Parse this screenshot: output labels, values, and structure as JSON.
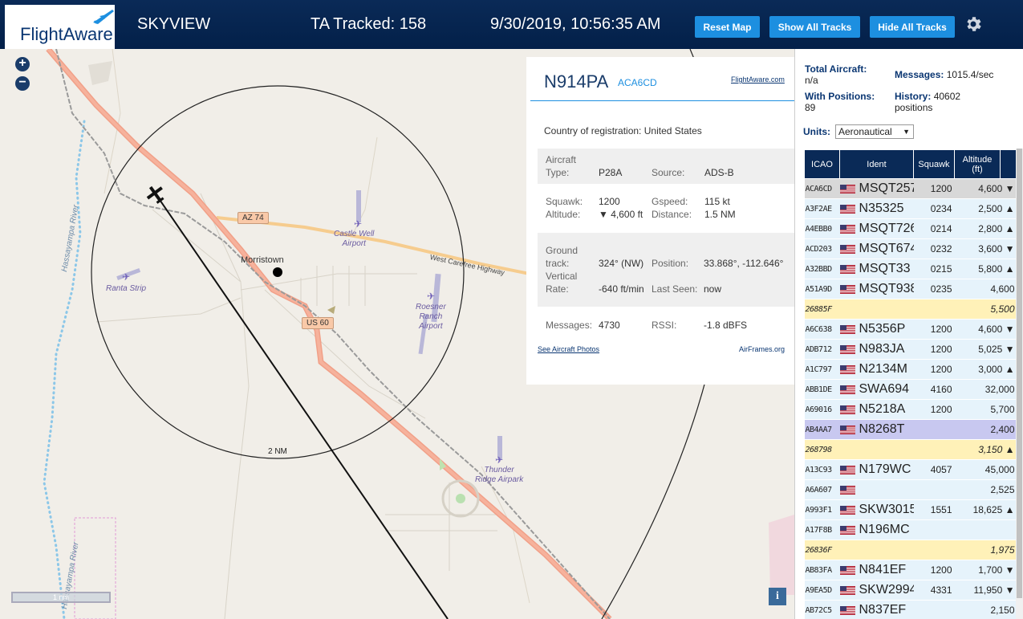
{
  "header": {
    "logo_text": "FlightAware",
    "title": "SKYVIEW",
    "tracked": "TA Tracked: 158",
    "datetime": "9/30/2019, 10:56:35 AM",
    "reset_map": "Reset Map",
    "show_all": "Show All Tracks",
    "hide_all": "Hide All Tracks"
  },
  "map": {
    "zoom_in": "+",
    "zoom_out": "−",
    "scale": "1 nm",
    "range_label": "2 NM",
    "info": "i",
    "town": "Morristown",
    "shields": [
      "AZ 74",
      "US 60"
    ],
    "highway": "West Carefree Highway",
    "river_1": "Hassayampa River",
    "river_2": "Hassayampa River",
    "airports": {
      "castle_well": "Castle Well\nAirport",
      "ranta": "Ranta Strip",
      "roesner": "Roesner\nRanch\nAirport",
      "thunder": "Thunder\nRidge Airpark"
    }
  },
  "selected": {
    "ident": "N914PA",
    "icao": "ACA6CD",
    "fa_link": "FlightAware.com",
    "country_label": "Country of registration:",
    "country": "United States",
    "aircraft_type_label": "Aircraft\nType:",
    "aircraft_type": "P28A",
    "source_label": "Source:",
    "source": "ADS-B",
    "squawk_label": "Squawk:",
    "squawk": "1200",
    "altitude_label": "Altitude:",
    "altitude": "▼ 4,600 ft",
    "gspeed_label": "Gspeed:",
    "gspeed": "115 kt",
    "distance_label": "Distance:",
    "distance": "1.5 NM",
    "track_label": "Ground\ntrack:",
    "track": "324° (NW)",
    "position_label": "Position:",
    "position": "33.868°, -112.646°",
    "vrate_label": "Vertical\nRate:",
    "vrate": "-640 ft/min",
    "lastseen_label": "Last Seen:",
    "lastseen": "now",
    "messages_label": "Messages:",
    "messages": "4730",
    "rssi_label": "RSSI:",
    "rssi": "-1.8 dBFS",
    "photos_link": "See Aircraft Photos",
    "airframes_link": "AirFrames.org"
  },
  "stats": {
    "total_label": "Total Aircraft:",
    "total": "n/a",
    "messages_label": "Messages:",
    "messages": "1015.4/sec",
    "withpos_label": "With Positions:",
    "withpos": "89",
    "history_label": "History:",
    "history": "40602 positions"
  },
  "units": {
    "label": "Units:",
    "value": "Aeronautical"
  },
  "table": {
    "headers": [
      "ICAO",
      "Ident",
      "Squawk",
      "Altitude\n(ft)"
    ],
    "rows": [
      {
        "icao": "ACA6CD",
        "flag": true,
        "ident": "MSQT257",
        "squawk": "1200",
        "alt": "4,600 ▼",
        "state": "selected"
      },
      {
        "icao": "A3F2AE",
        "flag": true,
        "ident": "N35325",
        "squawk": "0234",
        "alt": "2,500 ▲",
        "state": ""
      },
      {
        "icao": "A4EBB0",
        "flag": true,
        "ident": "MSQT726",
        "squawk": "0214",
        "alt": "2,800 ▲",
        "state": ""
      },
      {
        "icao": "ACD203",
        "flag": true,
        "ident": "MSQT674",
        "squawk": "0232",
        "alt": "3,600 ▼",
        "state": ""
      },
      {
        "icao": "A32BBD",
        "flag": true,
        "ident": "MSQT33",
        "squawk": "0215",
        "alt": "5,800 ▲",
        "state": ""
      },
      {
        "icao": "A51A9D",
        "flag": true,
        "ident": "MSQT938",
        "squawk": "0235",
        "alt": "4,600",
        "state": ""
      },
      {
        "icao": "26885F",
        "flag": false,
        "ident": "",
        "squawk": "",
        "alt": "5,500",
        "state": "nopos"
      },
      {
        "icao": "A6C638",
        "flag": true,
        "ident": "N5356P",
        "squawk": "1200",
        "alt": "4,600 ▼",
        "state": ""
      },
      {
        "icao": "ADB712",
        "flag": true,
        "ident": "N983JA",
        "squawk": "1200",
        "alt": "5,025 ▼",
        "state": ""
      },
      {
        "icao": "A1C797",
        "flag": true,
        "ident": "N2134M",
        "squawk": "1200",
        "alt": "3,000 ▲",
        "state": ""
      },
      {
        "icao": "ABB1DE",
        "flag": true,
        "ident": "SWA694",
        "squawk": "4160",
        "alt": "32,000",
        "state": ""
      },
      {
        "icao": "A69016",
        "flag": true,
        "ident": "N5218A",
        "squawk": "1200",
        "alt": "5,700",
        "state": ""
      },
      {
        "icao": "AB4AA7",
        "flag": true,
        "ident": "N8268T",
        "squawk": "",
        "alt": "2,400",
        "state": "highlight"
      },
      {
        "icao": "268798",
        "flag": false,
        "ident": "",
        "squawk": "",
        "alt": "3,150 ▲",
        "state": "nopos"
      },
      {
        "icao": "A13C93",
        "flag": true,
        "ident": "N179WC",
        "squawk": "4057",
        "alt": "45,000",
        "state": ""
      },
      {
        "icao": "A6A607",
        "flag": true,
        "ident": "",
        "squawk": "",
        "alt": "2,525",
        "state": ""
      },
      {
        "icao": "A993F1",
        "flag": true,
        "ident": "SKW3015",
        "squawk": "1551",
        "alt": "18,625 ▲",
        "state": ""
      },
      {
        "icao": "A17F8B",
        "flag": true,
        "ident": "N196MC",
        "squawk": "",
        "alt": "",
        "state": ""
      },
      {
        "icao": "26836F",
        "flag": false,
        "ident": "",
        "squawk": "",
        "alt": "1,975",
        "state": "nopos"
      },
      {
        "icao": "AB83FA",
        "flag": true,
        "ident": "N841EF",
        "squawk": "1200",
        "alt": "1,700 ▼",
        "state": ""
      },
      {
        "icao": "A9EA5D",
        "flag": true,
        "ident": "SKW2994",
        "squawk": "4331",
        "alt": "11,950 ▼",
        "state": ""
      },
      {
        "icao": "AB72C5",
        "flag": true,
        "ident": "N837EF",
        "squawk": "",
        "alt": "2,150",
        "state": ""
      }
    ]
  },
  "colors": {
    "header_bg": "#032049",
    "button": "#1d8fe0",
    "accent": "#1d8fe0",
    "major_road": "#f1a088",
    "highway": "#f6cc8e",
    "row_bg": "#e6f3fb",
    "row_nopos": "#fff1b8"
  }
}
